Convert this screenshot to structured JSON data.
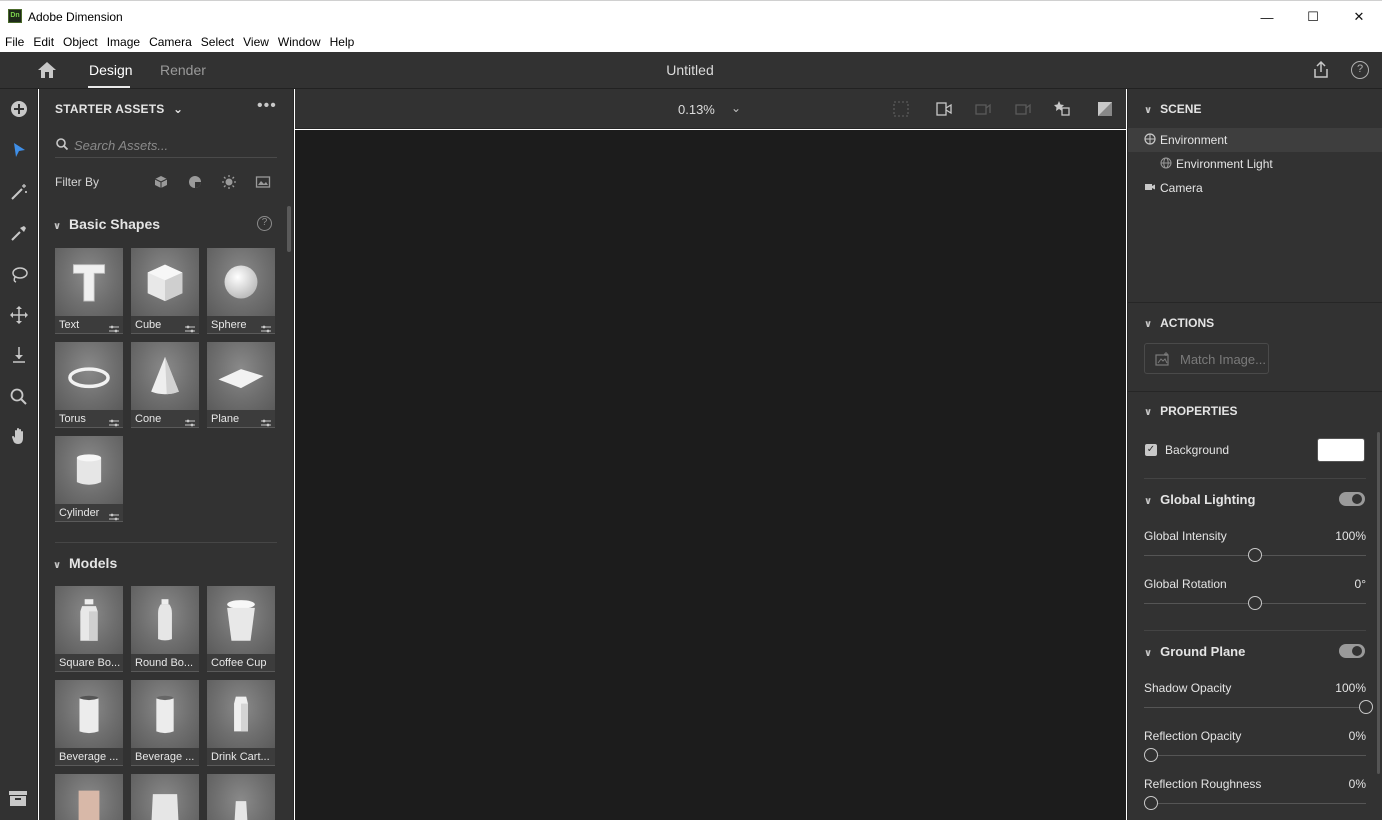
{
  "window": {
    "app_logo": "Dn",
    "title": "Adobe Dimension",
    "controls": {
      "minimize": "—",
      "maximize": "☐",
      "close": "✕"
    }
  },
  "menu": [
    "File",
    "Edit",
    "Object",
    "Image",
    "Camera",
    "Select",
    "View",
    "Window",
    "Help"
  ],
  "header": {
    "tabs": {
      "design": "Design",
      "render": "Render"
    },
    "active_tab": "Design",
    "document_title": "Untitled",
    "help_glyph": "?"
  },
  "left_tools": [
    "add-icon",
    "select-icon",
    "magic-wand-icon",
    "eyedropper-icon",
    "lasso-icon",
    "move-icon",
    "drop-to-ground-icon",
    "zoom-icon",
    "hand-icon"
  ],
  "assets": {
    "header": "STARTER ASSETS",
    "more": "•••",
    "search_placeholder": "Search Assets...",
    "filter_label": "Filter By",
    "filter_icons": [
      "models-filter-icon",
      "materials-filter-icon",
      "lights-filter-icon",
      "images-filter-icon"
    ],
    "basic_shapes": {
      "title": "Basic Shapes",
      "help": "?",
      "items": [
        "Text",
        "Cube",
        "Sphere",
        "Torus",
        "Cone",
        "Plane",
        "Cylinder"
      ]
    },
    "models": {
      "title": "Models",
      "items": [
        "Square Bo...",
        "Round Bo...",
        "Coffee Cup",
        "Beverage ...",
        "Beverage ...",
        "Drink Cart..."
      ]
    }
  },
  "viewport": {
    "zoom": "0.13%",
    "zoom_chevron": "⌄",
    "background": "#1c1c1c"
  },
  "scene": {
    "title": "SCENE",
    "items": [
      {
        "label": "Environment",
        "selected": true
      },
      {
        "label": "Environment Light",
        "selected": false
      },
      {
        "label": "Camera",
        "selected": false
      }
    ]
  },
  "actions": {
    "title": "ACTIONS",
    "match_image": "Match Image..."
  },
  "properties": {
    "title": "PROPERTIES",
    "background": {
      "label": "Background",
      "checked": true,
      "check_glyph": "✓",
      "color": "#ffffff"
    },
    "global_lighting": {
      "title": "Global Lighting",
      "enabled": true,
      "intensity_label": "Global Intensity",
      "intensity_value": "100%",
      "intensity_level": 0.5,
      "rotation_label": "Global Rotation",
      "rotation_value": "0°",
      "rotation_level": 0.5
    },
    "ground_plane": {
      "title": "Ground Plane",
      "enabled": true,
      "shadow_label": "Shadow Opacity",
      "shadow_value": "100%",
      "shadow_level": 1.0,
      "reflection_label": "Reflection Opacity",
      "reflection_value": "0%",
      "reflection_level": 0.0,
      "roughness_label": "Reflection Roughness",
      "roughness_value": "0%",
      "roughness_level": 0.0
    }
  }
}
